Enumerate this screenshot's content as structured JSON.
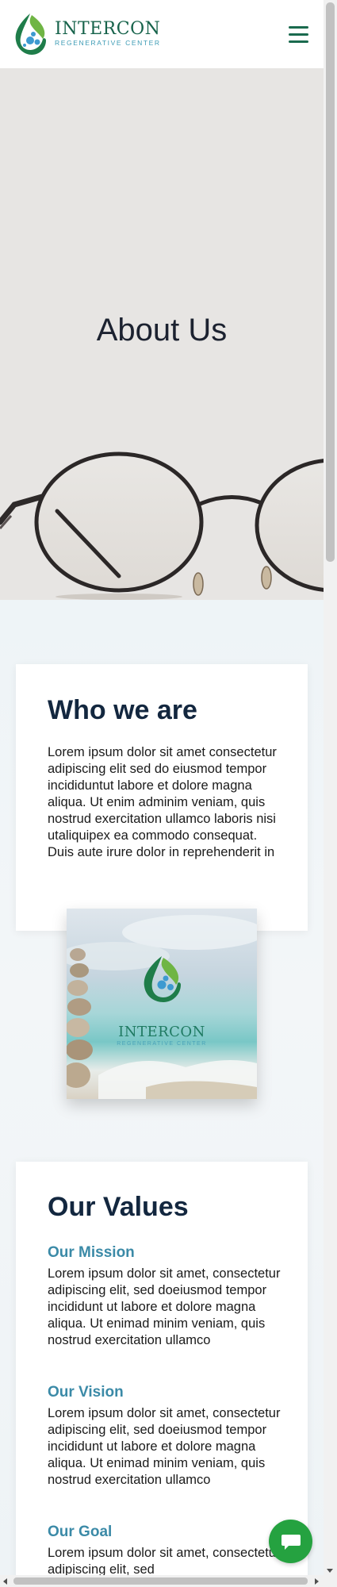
{
  "header": {
    "logo_name": "INTERCON",
    "logo_sub": "REGENERATIVE CENTER",
    "menu_icon": "hamburger-menu-icon"
  },
  "hero": {
    "title": "About Us"
  },
  "who": {
    "title": "Who we are",
    "text": "Lorem ipsum dolor sit amet consectetur adipiscing elit sed do eiusmod tempor incididuntut labore et dolore magna aliqua. Ut enim adminim veniam, quis nostrud exercitation ullamco laboris nisi utaliquipex ea commodo consequat. Duis aute irure dolor in reprehenderit in"
  },
  "brand_image": {
    "name": "INTERCON",
    "sub": "REGENERATIVE CENTER"
  },
  "values": {
    "title": "Our Values",
    "mission_title": "Our Mission",
    "mission_text": "Lorem ipsum dolor sit amet, consectetur adipiscing elit, sed doeiusmod tempor incididunt ut labore et dolore magna aliqua. Ut enimad minim veniam, quis nostrud exercitation ullamco",
    "vision_title": "Our Vision",
    "vision_text": "Lorem ipsum dolor sit amet, consectetur adipiscing elit, sed doeiusmod tempor incididunt ut labore et dolore magna aliqua. Ut enimad minim veniam, quis nostrud exercitation ullamco",
    "goal_title": "Our Goal",
    "goal_text": "Lorem ipsum dolor sit amet, consectetur adipiscing elit, sed"
  },
  "chat": {
    "icon": "chat-bubble-icon"
  },
  "colors": {
    "brand_green": "#17634b",
    "brand_blue": "#3c9bb5",
    "heading": "#13273f",
    "subheading": "#3b8aa7",
    "chat_green": "#25a240"
  }
}
